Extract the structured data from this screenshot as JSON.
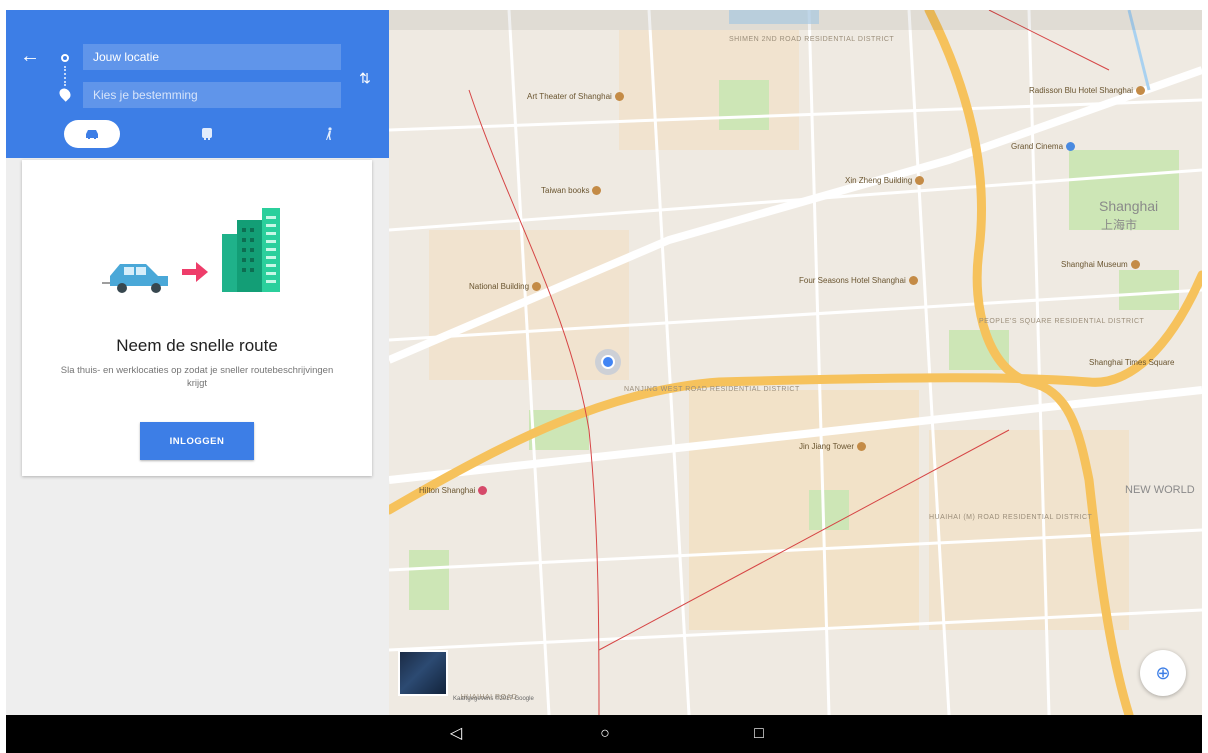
{
  "directions": {
    "origin_value": "Jouw locatie",
    "destination_placeholder": "Kies je bestemming",
    "modes": [
      {
        "name": "drive",
        "icon": "car-icon"
      },
      {
        "name": "transit",
        "icon": "train-icon"
      },
      {
        "name": "walk",
        "icon": "walking-icon"
      }
    ]
  },
  "card": {
    "title": "Neem de snelle route",
    "description": "Sla thuis- en werklocaties op zodat je sneller routebeschrijvingen krijgt",
    "login_label": "INLOGGEN"
  },
  "map": {
    "labels": {
      "art_theater": "Art Theater of Shanghai",
      "jingan_area": "SHIMEN 2ND ROAD RESIDENTIAL DISTRICT",
      "radisson": "Radisson Blu Hotel Shanghai",
      "grand_cinema": "Grand Cinema",
      "xin_zheng": "Xin Zheng Building",
      "shanghai": "Shanghai",
      "shanghai_cn": "上海市",
      "taiwan_books": "Taiwan books",
      "national_building": "National Building",
      "four_seasons": "Four Seasons Hotel Shanghai",
      "shanghai_museum": "Shanghai Museum",
      "peoples_square": "PEOPLE'S SQUARE RESIDENTIAL DISTRICT",
      "nanjing_west": "NANJING WEST ROAD RESIDENTIAL DISTRICT",
      "jin_jiang": "Jin Jiang Tower",
      "hilton": "Hilton Shanghai",
      "huaihai": "HUAIHAI (M) ROAD RESIDENTIAL DISTRICT",
      "new_world": "NEW WORLD",
      "shanghai_times": "Shanghai Times Square",
      "huaihai_road": "HUAIHAI ROAD"
    },
    "attribution": "Kaartgegevens ©2017 Google"
  },
  "navbar": {
    "back_icon": "back-triangle-icon",
    "home_icon": "home-circle-icon",
    "recents_icon": "recents-square-icon"
  },
  "colors": {
    "brand_blue": "#3d7ee6",
    "highway": "#f6c25c",
    "arterial": "#ffffff",
    "park": "#cde6b6",
    "water": "#a9d1f0"
  }
}
